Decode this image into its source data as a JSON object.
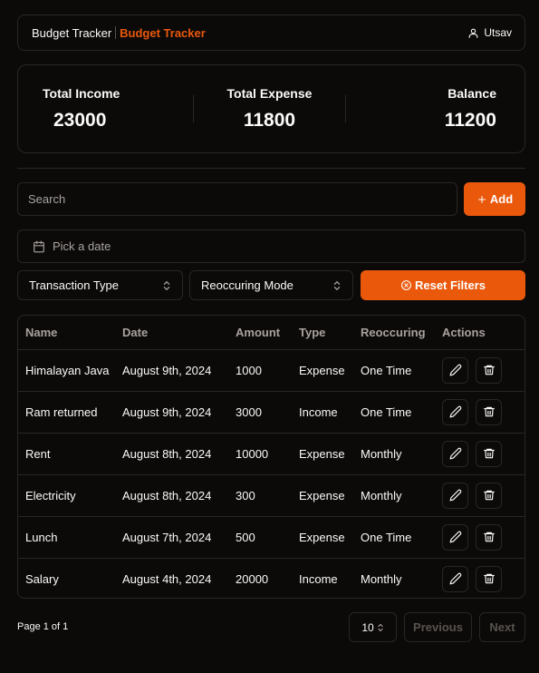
{
  "navbar": {
    "brand": "Budget Tracker",
    "brand_accent": "Budget Tracker",
    "user_name": "Utsav",
    "user_icon": "user-icon"
  },
  "summary": {
    "income_label": "Total Income",
    "income_value": "23000",
    "expense_label": "Total Expense",
    "expense_value": "11800",
    "balance_label": "Balance",
    "balance_value": "11200"
  },
  "search": {
    "placeholder": "Search",
    "value": ""
  },
  "add_button": {
    "label": "Add",
    "icon": "plus-icon"
  },
  "date_picker": {
    "placeholder": "Pick a date",
    "icon": "calendar-icon"
  },
  "filters": {
    "type_select": "Transaction Type",
    "mode_select": "Reoccuring Mode",
    "reset_label": "Reset Filters",
    "reset_icon": "circle-x-icon"
  },
  "table": {
    "headers": [
      "Name",
      "Date",
      "Amount",
      "Type",
      "Reoccuring",
      "Actions"
    ],
    "rows": [
      {
        "name": "Himalayan Java",
        "date": "August 9th, 2024",
        "amount": "1000",
        "type": "Expense",
        "reoccuring": "One Time"
      },
      {
        "name": "Ram returned",
        "date": "August 9th, 2024",
        "amount": "3000",
        "type": "Income",
        "reoccuring": "One Time"
      },
      {
        "name": "Rent",
        "date": "August 8th, 2024",
        "amount": "10000",
        "type": "Expense",
        "reoccuring": "Monthly"
      },
      {
        "name": "Electricity",
        "date": "August 8th, 2024",
        "amount": "300",
        "type": "Expense",
        "reoccuring": "Monthly"
      },
      {
        "name": "Lunch",
        "date": "August 7th, 2024",
        "amount": "500",
        "type": "Expense",
        "reoccuring": "One Time"
      },
      {
        "name": "Salary",
        "date": "August 4th, 2024",
        "amount": "20000",
        "type": "Income",
        "reoccuring": "Monthly"
      }
    ]
  },
  "pagination": {
    "page_info": "Page 1 of 1",
    "page_size": "10",
    "previous_label": "Previous",
    "next_label": "Next"
  },
  "colors": {
    "background": "#0c0a09",
    "accent": "#ea580c",
    "border": "#292524",
    "muted_text": "#a8a29e"
  }
}
